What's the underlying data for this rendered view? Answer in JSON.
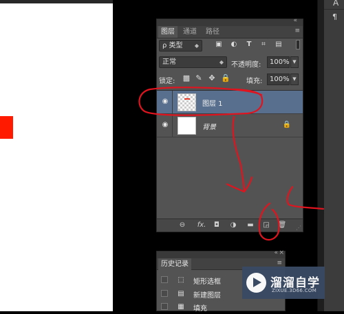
{
  "canvas": {
    "shape_color": "#ff1a00",
    "background_color": "#ffffff"
  },
  "right_dock": {
    "text_top": "A",
    "text_para": "¶"
  },
  "layers_panel": {
    "collapse_glyph": "«",
    "close_glyph": "×",
    "menu_glyph": "≡",
    "tabs": [
      "图层",
      "通道",
      "路径"
    ],
    "active_tab": "图层",
    "filter": {
      "label": "类型",
      "search_icon": "ρ"
    },
    "filter_icons": [
      "image-filter-icon",
      "adjustment-filter-icon",
      "text-filter-icon",
      "shape-filter-icon",
      "smart-object-filter-icon"
    ],
    "blend_mode": "正常",
    "opacity_label": "不透明度:",
    "opacity_value": "100%",
    "lock_label": "锁定:",
    "fill_label": "填充:",
    "fill_value": "100%",
    "layers": [
      {
        "name": "图层 1",
        "selected": true,
        "thumb": "transparent-with-red"
      },
      {
        "name": "背景",
        "selected": false,
        "thumb": "white",
        "locked": true
      }
    ],
    "bottom_icons": [
      "link-layers-icon",
      "fx-icon",
      "layer-mask-icon",
      "adjustment-layer-icon",
      "new-group-icon",
      "new-layer-icon",
      "delete-layer-icon"
    ],
    "fx_text": "fx."
  },
  "history_panel": {
    "collapse_glyph": "«",
    "close_glyph": "×",
    "menu_glyph": "≡",
    "tab": "历史记录",
    "items": [
      "矩形选框",
      "新建图层",
      "填充"
    ]
  },
  "watermark": {
    "title": "溜溜自学",
    "subtitle": "ZIXUE.3D66.COM"
  },
  "annotation_color": "#e0141e"
}
